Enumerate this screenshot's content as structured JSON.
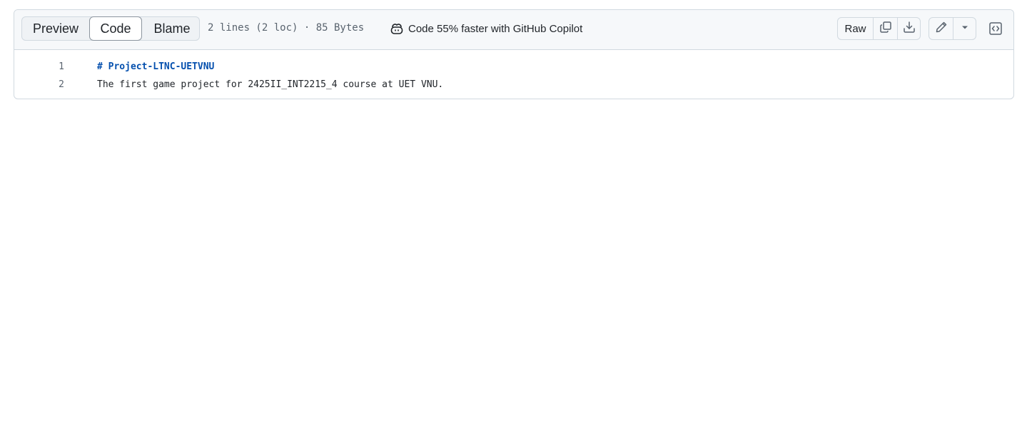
{
  "header": {
    "tabs": [
      {
        "label": "Preview",
        "active": false
      },
      {
        "label": "Code",
        "active": true
      },
      {
        "label": "Blame",
        "active": false
      }
    ],
    "file_info": "2 lines (2 loc) · 85 Bytes",
    "copilot_promo": "Code 55% faster with GitHub Copilot",
    "raw_label": "Raw",
    "icons": {
      "copilot": "copilot-icon",
      "copy": "copy-icon",
      "download": "download-icon",
      "edit": "pencil-icon",
      "more": "triangle-down-icon",
      "symbols": "code-square-icon"
    }
  },
  "code": {
    "lines": [
      {
        "number": "1",
        "text": "# Project-LTNC-UETVNU"
      },
      {
        "number": "2",
        "text": "The first game project for 2425II_INT2215_4 course at UET VNU."
      }
    ]
  },
  "colors": {
    "heading": "#0550ae",
    "border": "#d1d9e0",
    "header_bg": "#f6f8fa",
    "muted": "#59636e"
  }
}
